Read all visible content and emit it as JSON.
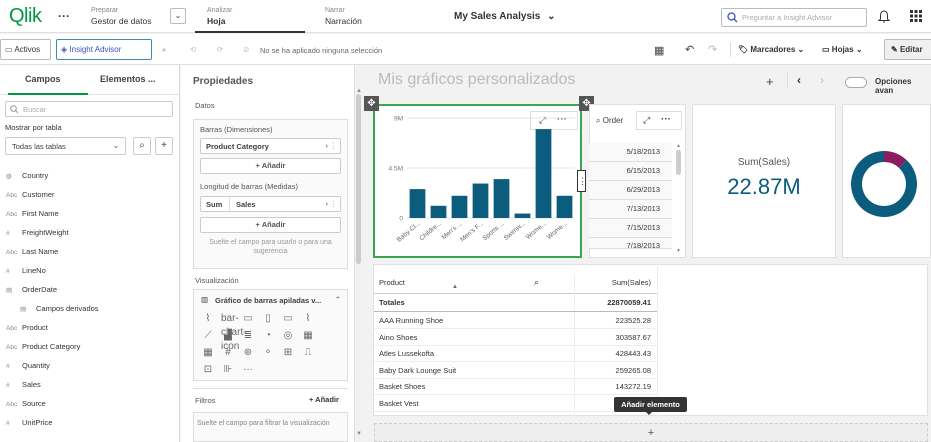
{
  "app": {
    "logo": "Qlik",
    "menu_dots": "···",
    "nav": [
      {
        "small": "Preparar",
        "big": "Gestor de datos"
      },
      {
        "small": "Analizar",
        "big": "Hoja"
      },
      {
        "small": "Narrar",
        "big": "Narración"
      }
    ],
    "title": "My Sales Analysis",
    "insight_search_placeholder": "Preguntar a Insight Advisor"
  },
  "toolbar": {
    "assets_label": "Activos",
    "insight_label": "Insight Advisor",
    "no_selection_text": "No se ha aplicado ninguna selección",
    "bookmarks_label": "Marcadores",
    "sheets_label": "Hojas",
    "edit_label": "Editar"
  },
  "left_panel": {
    "tabs": [
      "Campos",
      "Elementos ..."
    ],
    "search_placeholder": "Buscar",
    "show_by_label": "Mostrar por tabla",
    "table_select": "Todas las tablas",
    "fields": [
      {
        "type": "geo",
        "name": "Country"
      },
      {
        "type": "Abc",
        "name": "Customer"
      },
      {
        "type": "Abc",
        "name": "First Name"
      },
      {
        "type": "#",
        "name": "FreightWeight"
      },
      {
        "type": "Abc",
        "name": "Last Name"
      },
      {
        "type": "#",
        "name": "LineNo"
      },
      {
        "type": "cal",
        "name": "OrderDate"
      },
      {
        "type": "sub",
        "name": "Campos derivados"
      },
      {
        "type": "Abc",
        "name": "Product"
      },
      {
        "type": "Abc",
        "name": "Product Category"
      },
      {
        "type": "#",
        "name": "Quantity"
      },
      {
        "type": "#",
        "name": "Sales"
      },
      {
        "type": "Abc",
        "name": "Source"
      },
      {
        "type": "#",
        "name": "UnitPrice"
      }
    ]
  },
  "properties": {
    "title": "Propiedades",
    "data_label": "Datos",
    "dimensions_label": "Barras (Dimensiones)",
    "dimension_value": "Product Category",
    "add_label": "+ Añadir",
    "measures_label": "Longitud de barras (Medidas)",
    "measure_agg": "Sum",
    "measure_field": "Sales",
    "drop_hint": "Suelte el campo para usarlo o para una sugerencia",
    "viz_label": "Visualización",
    "viz_select": "Gráfico de barras apiladas v...",
    "more": "···",
    "filters_label": "Filtros",
    "filters_add": "+ Añadir",
    "filters_hint": "Suelte el campo para filtrar la visualización"
  },
  "main": {
    "title": "Mis gráficos personalizados",
    "options_label": "Opciones avan",
    "add_element_tooltip": "Añadir elemento",
    "add_plus": "+"
  },
  "bar_chart": {
    "chart_data": {
      "type": "bar",
      "categories": [
        "Baby Cl...",
        "Childre...",
        "Men's ...",
        "Men's F...",
        "Sports ...",
        "Swimw...",
        "Wome...",
        "Wome..."
      ],
      "values": [
        2.6,
        1.1,
        2.0,
        3.1,
        3.5,
        0.4,
        8.0,
        2.0
      ],
      "y_ticks": [
        "9M",
        "4.5M",
        "0"
      ],
      "ylim": [
        0,
        9
      ]
    },
    "more": "···"
  },
  "date_list": {
    "header": "Order",
    "dates": [
      "5/18/2013",
      "6/15/2013",
      "6/29/2013",
      "7/13/2013",
      "7/15/2013",
      "7/18/2013"
    ]
  },
  "kpi": {
    "label": "Sum(Sales)",
    "value": "22.87M"
  },
  "donut": {
    "chart_data": {
      "type": "pie",
      "values": [
        88,
        12
      ],
      "colors": [
        "#0b5c7d",
        "#8c1c5f"
      ]
    }
  },
  "table": {
    "headers": [
      "Product",
      "Sum(Sales)"
    ],
    "totals": {
      "label": "Totales",
      "value": "22870059.41"
    },
    "rows": [
      {
        "product": "AAA Running Shoe",
        "sales": "223525.28"
      },
      {
        "product": "Aino Shoes",
        "sales": "303587.67"
      },
      {
        "product": "Atles Lussekofta",
        "sales": "428443.43"
      },
      {
        "product": "Baby Dark Lounge Suit",
        "sales": "259265.08"
      },
      {
        "product": "Basket Shoes",
        "sales": "143272.19"
      },
      {
        "product": "Basket Vest",
        "sales": ""
      }
    ]
  },
  "colors": {
    "accent": "#009845",
    "bar": "#0b5c7d",
    "selected": "#3aa653"
  }
}
